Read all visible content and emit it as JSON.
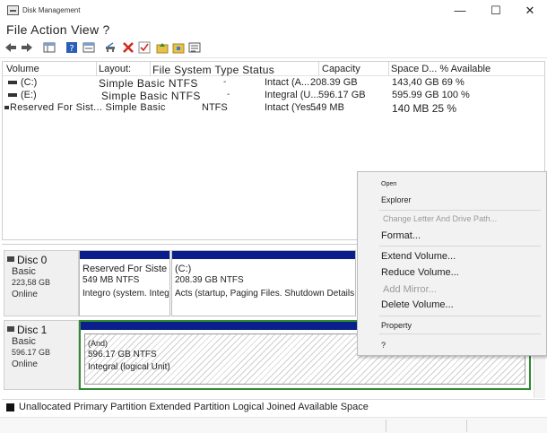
{
  "window": {
    "title": "Disk Management",
    "minimize_glyph": "—",
    "maximize_glyph": "☐",
    "close_glyph": "✕"
  },
  "menubar": {
    "label": "File Action View ?"
  },
  "toolbar": {
    "icons": [
      "back-arrow-icon",
      "forward-arrow-icon",
      "console-tree-icon",
      "help-icon",
      "properties-icon",
      "connect-icon",
      "delete-icon",
      "check-icon",
      "folder-up-icon",
      "folder-open-icon",
      "list-view-icon"
    ]
  },
  "volume_table": {
    "headers": {
      "volume": "Volume",
      "layout": "Layout:",
      "fs_type_status": "File System Type Status",
      "capacity": "Capacity",
      "space_free": "Space D... % Available"
    },
    "rows": [
      {
        "volume": "(C:)",
        "layout": "Simple Basic NTFS",
        "fs": "-",
        "status": "Intact (A...",
        "capacity": "208.39 GB",
        "space": "143,40 GB 69 %"
      },
      {
        "volume": "(E:)",
        "layout": "Simple Basic NTFS",
        "fs": "-",
        "status": "Integral (U...",
        "capacity": "596.17 GB",
        "space": "595.99 GB 100 %"
      },
      {
        "volume": "Reserved For Sist... Simple Basic",
        "layout": "",
        "fs": "NTFS",
        "status": "Intact (Yes...",
        "capacity": "549 MB",
        "space": "140 MB 25 %"
      }
    ]
  },
  "disks": [
    {
      "title": "Disc 0",
      "type": "Basic",
      "size": "223,58 GB",
      "state": "Online",
      "partitions": [
        {
          "name": "Reserved For Siste",
          "size": "549 MB NTFS",
          "status": "Integro (system. Integro"
        },
        {
          "name": "(C:)",
          "size": "208.39 GB NTFS",
          "status": "Acts (startup, Paging Files. Shutdown Details"
        }
      ]
    },
    {
      "title": "Disc 1",
      "type": "Basic",
      "size": "596.17 GB",
      "state": "Online",
      "partitions": [
        {
          "name": "(And)",
          "size": "596.17 GB NTFS",
          "status": "Integral (logical Unit)"
        }
      ]
    }
  ],
  "legend": {
    "text": "Unallocated Primary Partition Extended Partition Logical Joined Available Space"
  },
  "context_menu": {
    "items": {
      "open": "Ореп",
      "explorer": "Explorer",
      "change_letter": "Change Letter And Drive Path...",
      "format": "Format...",
      "extend": "Extend Volume...",
      "reduce": "Reduce Volume...",
      "add_mirror": "Add Mirror...",
      "delete": "Delete Volume...",
      "property": "Property",
      "help": "?"
    }
  },
  "colors": {
    "partition_bar": "#0b1f8c",
    "disk1_selection": "#2e8b2e",
    "panel_bg": "#f0f0f0"
  }
}
